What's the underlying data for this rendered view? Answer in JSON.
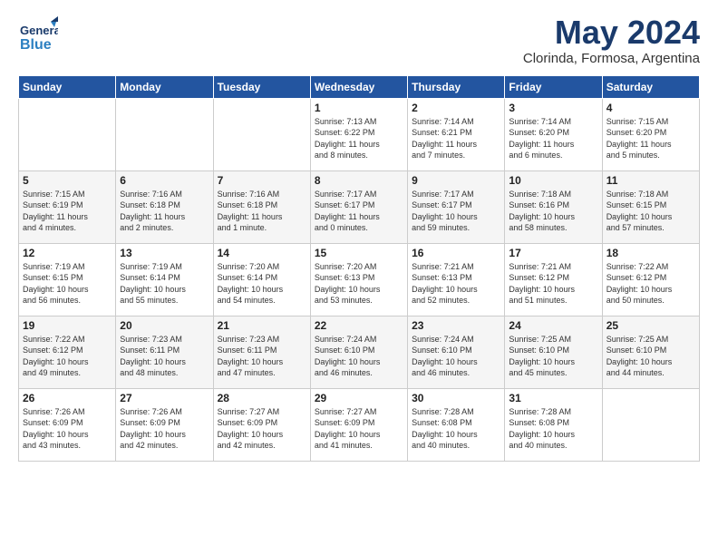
{
  "header": {
    "logo_general": "General",
    "logo_blue": "Blue",
    "main_title": "May 2024",
    "sub_title": "Clorinda, Formosa, Argentina"
  },
  "days_of_week": [
    "Sunday",
    "Monday",
    "Tuesday",
    "Wednesday",
    "Thursday",
    "Friday",
    "Saturday"
  ],
  "weeks": [
    [
      {
        "day": "",
        "info": ""
      },
      {
        "day": "",
        "info": ""
      },
      {
        "day": "",
        "info": ""
      },
      {
        "day": "1",
        "info": "Sunrise: 7:13 AM\nSunset: 6:22 PM\nDaylight: 11 hours\nand 8 minutes."
      },
      {
        "day": "2",
        "info": "Sunrise: 7:14 AM\nSunset: 6:21 PM\nDaylight: 11 hours\nand 7 minutes."
      },
      {
        "day": "3",
        "info": "Sunrise: 7:14 AM\nSunset: 6:20 PM\nDaylight: 11 hours\nand 6 minutes."
      },
      {
        "day": "4",
        "info": "Sunrise: 7:15 AM\nSunset: 6:20 PM\nDaylight: 11 hours\nand 5 minutes."
      }
    ],
    [
      {
        "day": "5",
        "info": "Sunrise: 7:15 AM\nSunset: 6:19 PM\nDaylight: 11 hours\nand 4 minutes."
      },
      {
        "day": "6",
        "info": "Sunrise: 7:16 AM\nSunset: 6:18 PM\nDaylight: 11 hours\nand 2 minutes."
      },
      {
        "day": "7",
        "info": "Sunrise: 7:16 AM\nSunset: 6:18 PM\nDaylight: 11 hours\nand 1 minute."
      },
      {
        "day": "8",
        "info": "Sunrise: 7:17 AM\nSunset: 6:17 PM\nDaylight: 11 hours\nand 0 minutes."
      },
      {
        "day": "9",
        "info": "Sunrise: 7:17 AM\nSunset: 6:17 PM\nDaylight: 10 hours\nand 59 minutes."
      },
      {
        "day": "10",
        "info": "Sunrise: 7:18 AM\nSunset: 6:16 PM\nDaylight: 10 hours\nand 58 minutes."
      },
      {
        "day": "11",
        "info": "Sunrise: 7:18 AM\nSunset: 6:15 PM\nDaylight: 10 hours\nand 57 minutes."
      }
    ],
    [
      {
        "day": "12",
        "info": "Sunrise: 7:19 AM\nSunset: 6:15 PM\nDaylight: 10 hours\nand 56 minutes."
      },
      {
        "day": "13",
        "info": "Sunrise: 7:19 AM\nSunset: 6:14 PM\nDaylight: 10 hours\nand 55 minutes."
      },
      {
        "day": "14",
        "info": "Sunrise: 7:20 AM\nSunset: 6:14 PM\nDaylight: 10 hours\nand 54 minutes."
      },
      {
        "day": "15",
        "info": "Sunrise: 7:20 AM\nSunset: 6:13 PM\nDaylight: 10 hours\nand 53 minutes."
      },
      {
        "day": "16",
        "info": "Sunrise: 7:21 AM\nSunset: 6:13 PM\nDaylight: 10 hours\nand 52 minutes."
      },
      {
        "day": "17",
        "info": "Sunrise: 7:21 AM\nSunset: 6:12 PM\nDaylight: 10 hours\nand 51 minutes."
      },
      {
        "day": "18",
        "info": "Sunrise: 7:22 AM\nSunset: 6:12 PM\nDaylight: 10 hours\nand 50 minutes."
      }
    ],
    [
      {
        "day": "19",
        "info": "Sunrise: 7:22 AM\nSunset: 6:12 PM\nDaylight: 10 hours\nand 49 minutes."
      },
      {
        "day": "20",
        "info": "Sunrise: 7:23 AM\nSunset: 6:11 PM\nDaylight: 10 hours\nand 48 minutes."
      },
      {
        "day": "21",
        "info": "Sunrise: 7:23 AM\nSunset: 6:11 PM\nDaylight: 10 hours\nand 47 minutes."
      },
      {
        "day": "22",
        "info": "Sunrise: 7:24 AM\nSunset: 6:10 PM\nDaylight: 10 hours\nand 46 minutes."
      },
      {
        "day": "23",
        "info": "Sunrise: 7:24 AM\nSunset: 6:10 PM\nDaylight: 10 hours\nand 46 minutes."
      },
      {
        "day": "24",
        "info": "Sunrise: 7:25 AM\nSunset: 6:10 PM\nDaylight: 10 hours\nand 45 minutes."
      },
      {
        "day": "25",
        "info": "Sunrise: 7:25 AM\nSunset: 6:10 PM\nDaylight: 10 hours\nand 44 minutes."
      }
    ],
    [
      {
        "day": "26",
        "info": "Sunrise: 7:26 AM\nSunset: 6:09 PM\nDaylight: 10 hours\nand 43 minutes."
      },
      {
        "day": "27",
        "info": "Sunrise: 7:26 AM\nSunset: 6:09 PM\nDaylight: 10 hours\nand 42 minutes."
      },
      {
        "day": "28",
        "info": "Sunrise: 7:27 AM\nSunset: 6:09 PM\nDaylight: 10 hours\nand 42 minutes."
      },
      {
        "day": "29",
        "info": "Sunrise: 7:27 AM\nSunset: 6:09 PM\nDaylight: 10 hours\nand 41 minutes."
      },
      {
        "day": "30",
        "info": "Sunrise: 7:28 AM\nSunset: 6:08 PM\nDaylight: 10 hours\nand 40 minutes."
      },
      {
        "day": "31",
        "info": "Sunrise: 7:28 AM\nSunset: 6:08 PM\nDaylight: 10 hours\nand 40 minutes."
      },
      {
        "day": "",
        "info": ""
      }
    ]
  ]
}
